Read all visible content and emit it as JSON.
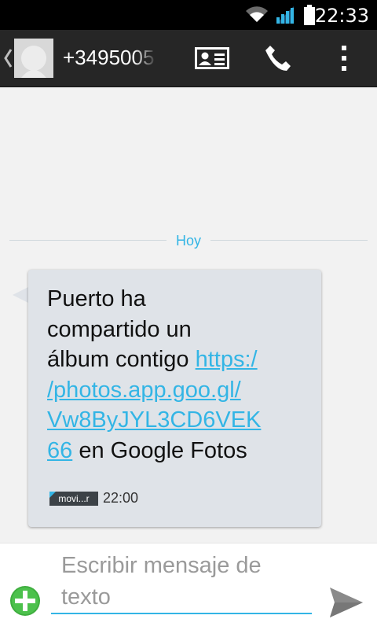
{
  "status_bar": {
    "time": "22:33",
    "icons": [
      "wifi-icon",
      "signal-icon",
      "battery-icon"
    ]
  },
  "action_bar": {
    "contact": "+3495005",
    "buttons": [
      "contact-card-icon",
      "phone-icon",
      "overflow-menu-icon"
    ]
  },
  "conversation": {
    "date_divider": "Hoy",
    "messages": [
      {
        "text_before": "Puerto ha compartido un álbum contigo ",
        "link_lines": [
          "https:/",
          "/photos.app.goo.gl/",
          "Vw8ByJYL3CD6VEK",
          "66"
        ],
        "text_line1": "Puerto ha",
        "text_line2": "compartido un",
        "text_line3": "álbum contigo",
        "text_after": "en Google Fotos",
        "sim_label": "movi...r",
        "time": "22:00"
      }
    ]
  },
  "compose": {
    "placeholder": "Escribir mensaje de texto",
    "value": ""
  },
  "colors": {
    "accent": "#33b5e5",
    "action_bar": "#262626",
    "bubble": "#dfe3e8",
    "attach_green": "#4caf50"
  }
}
